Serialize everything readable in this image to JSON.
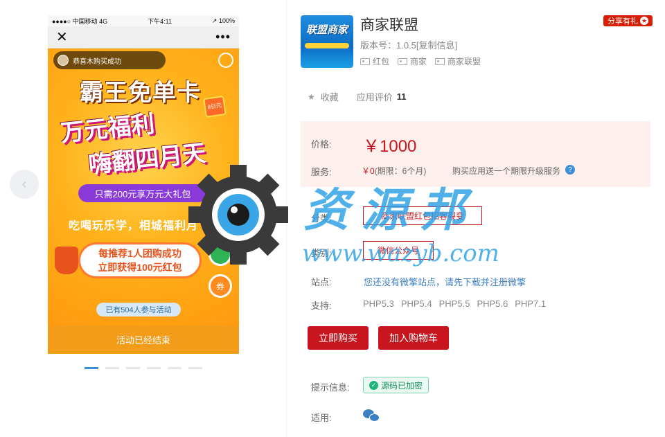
{
  "gallery": {
    "status_bar": {
      "carrier": "●●●●○ 中国移动 4G",
      "time": "下午4:11",
      "battery": "↗ 100%"
    },
    "wx_bar": {
      "close": "✕",
      "more": "•••"
    },
    "poster": {
      "notice": "恭喜木购买成功",
      "title": "霸王免单卡",
      "ticket": "8日元",
      "line1": "万元福利",
      "line2": "嗨翻四月天",
      "offer": "只需200元享万元大礼包",
      "slogan": "吃喝玩乐学，相城福利月",
      "promo_line1": "每推荐1人团购成功",
      "promo_line2": "立即获得100元红包",
      "coupon": "券",
      "joined": "已有504人参与活动",
      "ended": "活动已经结束"
    },
    "prev_arrow": "‹",
    "slide_count": 6,
    "active_slide": 1
  },
  "app": {
    "icon_text": "联盟商家",
    "name": "商家联盟",
    "version": "版本号：1.0.5[复制信息]",
    "tags": [
      "红包",
      "商家",
      "商家联盟"
    ],
    "share_gift": "分享有礼"
  },
  "stats": {
    "favorite": "收藏",
    "rating_label": "应用评价",
    "rating_value": "11"
  },
  "pricing": {
    "price_label": "价格:",
    "price": "￥1000",
    "service_label": "服务:",
    "service_price": "￥0",
    "service_period": "(期限：6个月)",
    "service_note": "购买应用送一个期限升级服务",
    "help": "?"
  },
  "details": {
    "category_label": "分类:",
    "category": "商家联盟红包招客裂变",
    "type_label": "类别:",
    "type": "微信公众号",
    "site_label": "站点:",
    "site": "您还没有微擎站点，请先下载并注册微擎",
    "support_label": "支持:",
    "support": [
      "PHP5.3",
      "PHP5.4",
      "PHP5.5",
      "PHP5.6",
      "PHP7.1"
    ]
  },
  "actions": {
    "buy": "立即购买",
    "cart": "加入购物车"
  },
  "info": {
    "hint_label": "提示信息:",
    "encrypted": "源码已加密",
    "apply_label": "适用:"
  },
  "watermark": {
    "title": "资源邦",
    "url": "www.wazyb.com"
  },
  "colors": {
    "accent_red": "#c9151e",
    "link_blue": "#3d7fc4",
    "price_bg": "#fdefeb",
    "watermark_blue": "#2aa0e6"
  }
}
